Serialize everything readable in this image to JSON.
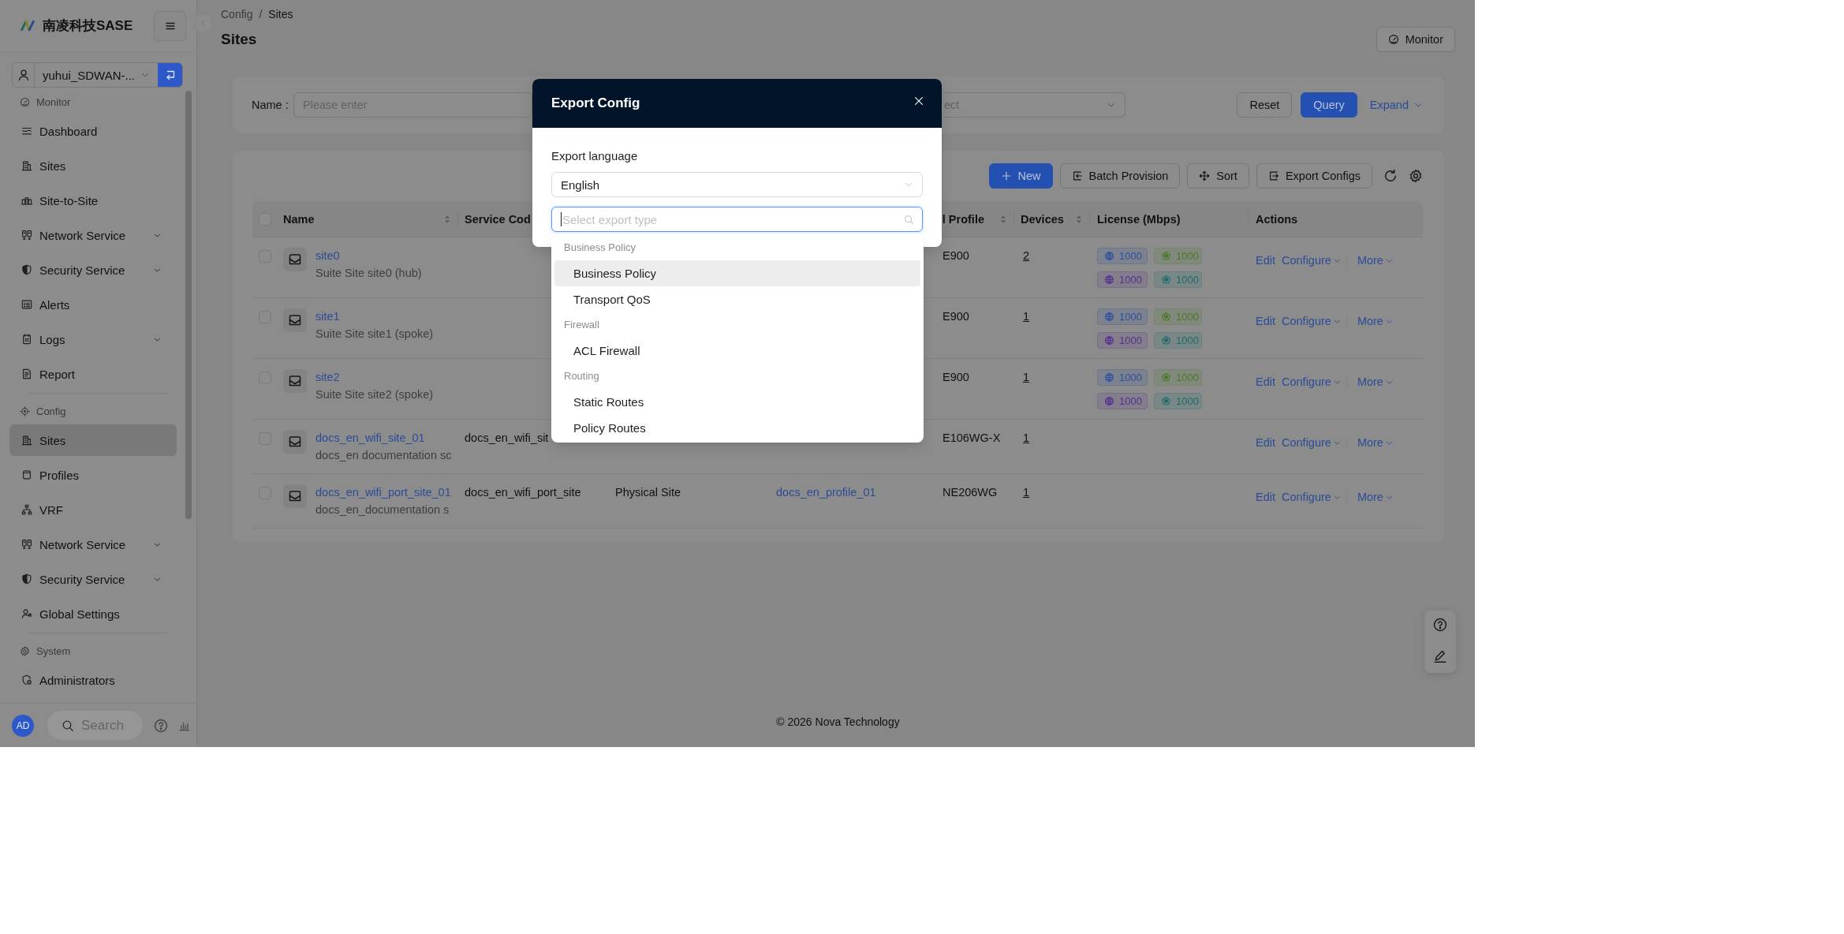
{
  "sidebar": {
    "brand": "南凌科技SASE",
    "tenant": {
      "value": "yuhui_SDWAN-..."
    },
    "groups": [
      {
        "title": "Monitor",
        "items": [
          {
            "label": "Dashboard",
            "kind": "link",
            "selected": false
          },
          {
            "label": "Sites",
            "kind": "link",
            "selected": false
          },
          {
            "label": "Site-to-Site",
            "kind": "link",
            "selected": false
          },
          {
            "label": "Network Service",
            "kind": "submenu",
            "selected": false
          },
          {
            "label": "Security Service",
            "kind": "submenu",
            "selected": false
          },
          {
            "label": "Alerts",
            "kind": "link",
            "selected": false
          },
          {
            "label": "Logs",
            "kind": "submenu",
            "selected": false
          },
          {
            "label": "Report",
            "kind": "link",
            "selected": false
          }
        ]
      },
      {
        "title": "Config",
        "items": [
          {
            "label": "Sites",
            "kind": "link",
            "selected": true
          },
          {
            "label": "Profiles",
            "kind": "link",
            "selected": false
          },
          {
            "label": "VRF",
            "kind": "link",
            "selected": false
          },
          {
            "label": "Network Service",
            "kind": "submenu",
            "selected": false
          },
          {
            "label": "Security Service",
            "kind": "submenu",
            "selected": false
          },
          {
            "label": "Global Settings",
            "kind": "link",
            "selected": false
          }
        ]
      },
      {
        "title": "System",
        "items": [
          {
            "label": "Administrators",
            "kind": "link",
            "selected": false
          }
        ]
      }
    ],
    "footer": {
      "avatar": "AD",
      "search": {
        "placeholder": "Search"
      }
    }
  },
  "breadcrumb": {
    "items": [
      "Config",
      "Sites"
    ],
    "separator": "/"
  },
  "page_title": "Sites",
  "header_buttons": [
    "Monitor"
  ],
  "filter": {
    "fields": [
      {
        "kind": "input",
        "label": "Name :",
        "placeholder": "Please enter"
      },
      {
        "kind": "select",
        "placeholder": "ect"
      }
    ],
    "buttons": [
      {
        "label": "Reset",
        "kind": "default"
      },
      {
        "label": "Query",
        "kind": "primary"
      },
      {
        "label": "Expand",
        "kind": "link"
      }
    ]
  },
  "toolbar": {
    "buttons": [
      {
        "label": "New",
        "kind": "primary"
      },
      {
        "label": "Batch Provision",
        "kind": "default"
      },
      {
        "label": "Sort",
        "kind": "default"
      },
      {
        "label": "Export Configs",
        "kind": "default"
      }
    ]
  },
  "table": {
    "header_checked": false,
    "columns": [
      {
        "label": "Name",
        "sortable": true
      },
      {
        "label": "Service Cod"
      },
      {
        "label": "l Profile",
        "sortable": true
      },
      {
        "label": "Devices",
        "sortable": true
      },
      {
        "label": "License (Mbps)"
      },
      {
        "label": "Actions"
      }
    ],
    "rows": [
      {
        "checked": false,
        "name": "site0",
        "description": "Suite Site site0 (hub)",
        "column_5": "E900",
        "devices": "2",
        "licenses": [
          {
            "value": "1000",
            "color": "#2c4f9e"
          },
          {
            "value": "1000",
            "color": "#4a7826"
          },
          {
            "value": "1000",
            "color": "#54308e"
          },
          {
            "value": "1000",
            "color": "#1d6a6a"
          }
        ],
        "actions": [
          {
            "label": "Edit",
            "kind": "link"
          },
          {
            "label": "Configure",
            "kind": "menu"
          },
          {
            "label": "More",
            "kind": "menu"
          }
        ]
      },
      {
        "checked": false,
        "name": "site1",
        "description": "Suite Site site1 (spoke)",
        "column_5": "E900",
        "devices": "1",
        "licenses": [
          {
            "value": "1000",
            "color": "#2c4f9e"
          },
          {
            "value": "1000",
            "color": "#4a7826"
          },
          {
            "value": "1000",
            "color": "#54308e"
          },
          {
            "value": "1000",
            "color": "#1d6a6a"
          }
        ],
        "actions": [
          {
            "label": "Edit",
            "kind": "link"
          },
          {
            "label": "Configure",
            "kind": "menu"
          },
          {
            "label": "More",
            "kind": "menu"
          }
        ]
      },
      {
        "checked": false,
        "name": "site2",
        "description": "Suite Site site2 (spoke)",
        "column_5": "E900",
        "devices": "1",
        "licenses": [
          {
            "value": "1000",
            "color": "#2c4f9e"
          },
          {
            "value": "1000",
            "color": "#4a7826"
          },
          {
            "value": "1000",
            "color": "#54308e"
          },
          {
            "value": "1000",
            "color": "#1d6a6a"
          }
        ],
        "actions": [
          {
            "label": "Edit",
            "kind": "link"
          },
          {
            "label": "Configure",
            "kind": "menu"
          },
          {
            "label": "More",
            "kind": "menu"
          }
        ]
      },
      {
        "checked": false,
        "name": "docs_en_wifi_site_01",
        "description": "docs_en documentation sc",
        "service_code": "docs_en_wifi_sit",
        "column_5": "E106WG-X",
        "devices": "1",
        "actions": [
          {
            "label": "Edit",
            "kind": "link"
          },
          {
            "label": "Configure",
            "kind": "menu"
          },
          {
            "label": "More",
            "kind": "menu"
          }
        ]
      },
      {
        "checked": false,
        "name": "docs_en_wifi_port_site_01",
        "description": "docs_en_documentation s",
        "service_code": "docs_en_wifi_port_site",
        "column_3": "Physical Site",
        "column_4": "docs_en_profile_01",
        "column_5": "NE206WG",
        "devices": "1",
        "actions": [
          {
            "label": "Edit",
            "kind": "link"
          },
          {
            "label": "Configure",
            "kind": "menu"
          },
          {
            "label": "More",
            "kind": "menu"
          }
        ]
      }
    ]
  },
  "footer_text": "© 2026 Nova Technology",
  "modal": {
    "title": "Export Config",
    "fields": [
      {
        "kind": "select",
        "label": "Export language",
        "value": "English"
      },
      {
        "kind": "search",
        "placeholder": "Select export type",
        "focused": true
      }
    ]
  },
  "dropdown": {
    "groups": [
      {
        "title": "Business Policy",
        "options": [
          {
            "label": "Business Policy",
            "highlighted": true
          },
          {
            "label": "Transport QoS",
            "highlighted": false
          }
        ]
      },
      {
        "title": "Firewall",
        "options": [
          {
            "label": "ACL Firewall",
            "highlighted": false
          }
        ]
      },
      {
        "title": "Routing",
        "options": [
          {
            "label": "Static Routes",
            "highlighted": false
          },
          {
            "label": "Policy Routes",
            "highlighted": false
          }
        ]
      }
    ]
  }
}
